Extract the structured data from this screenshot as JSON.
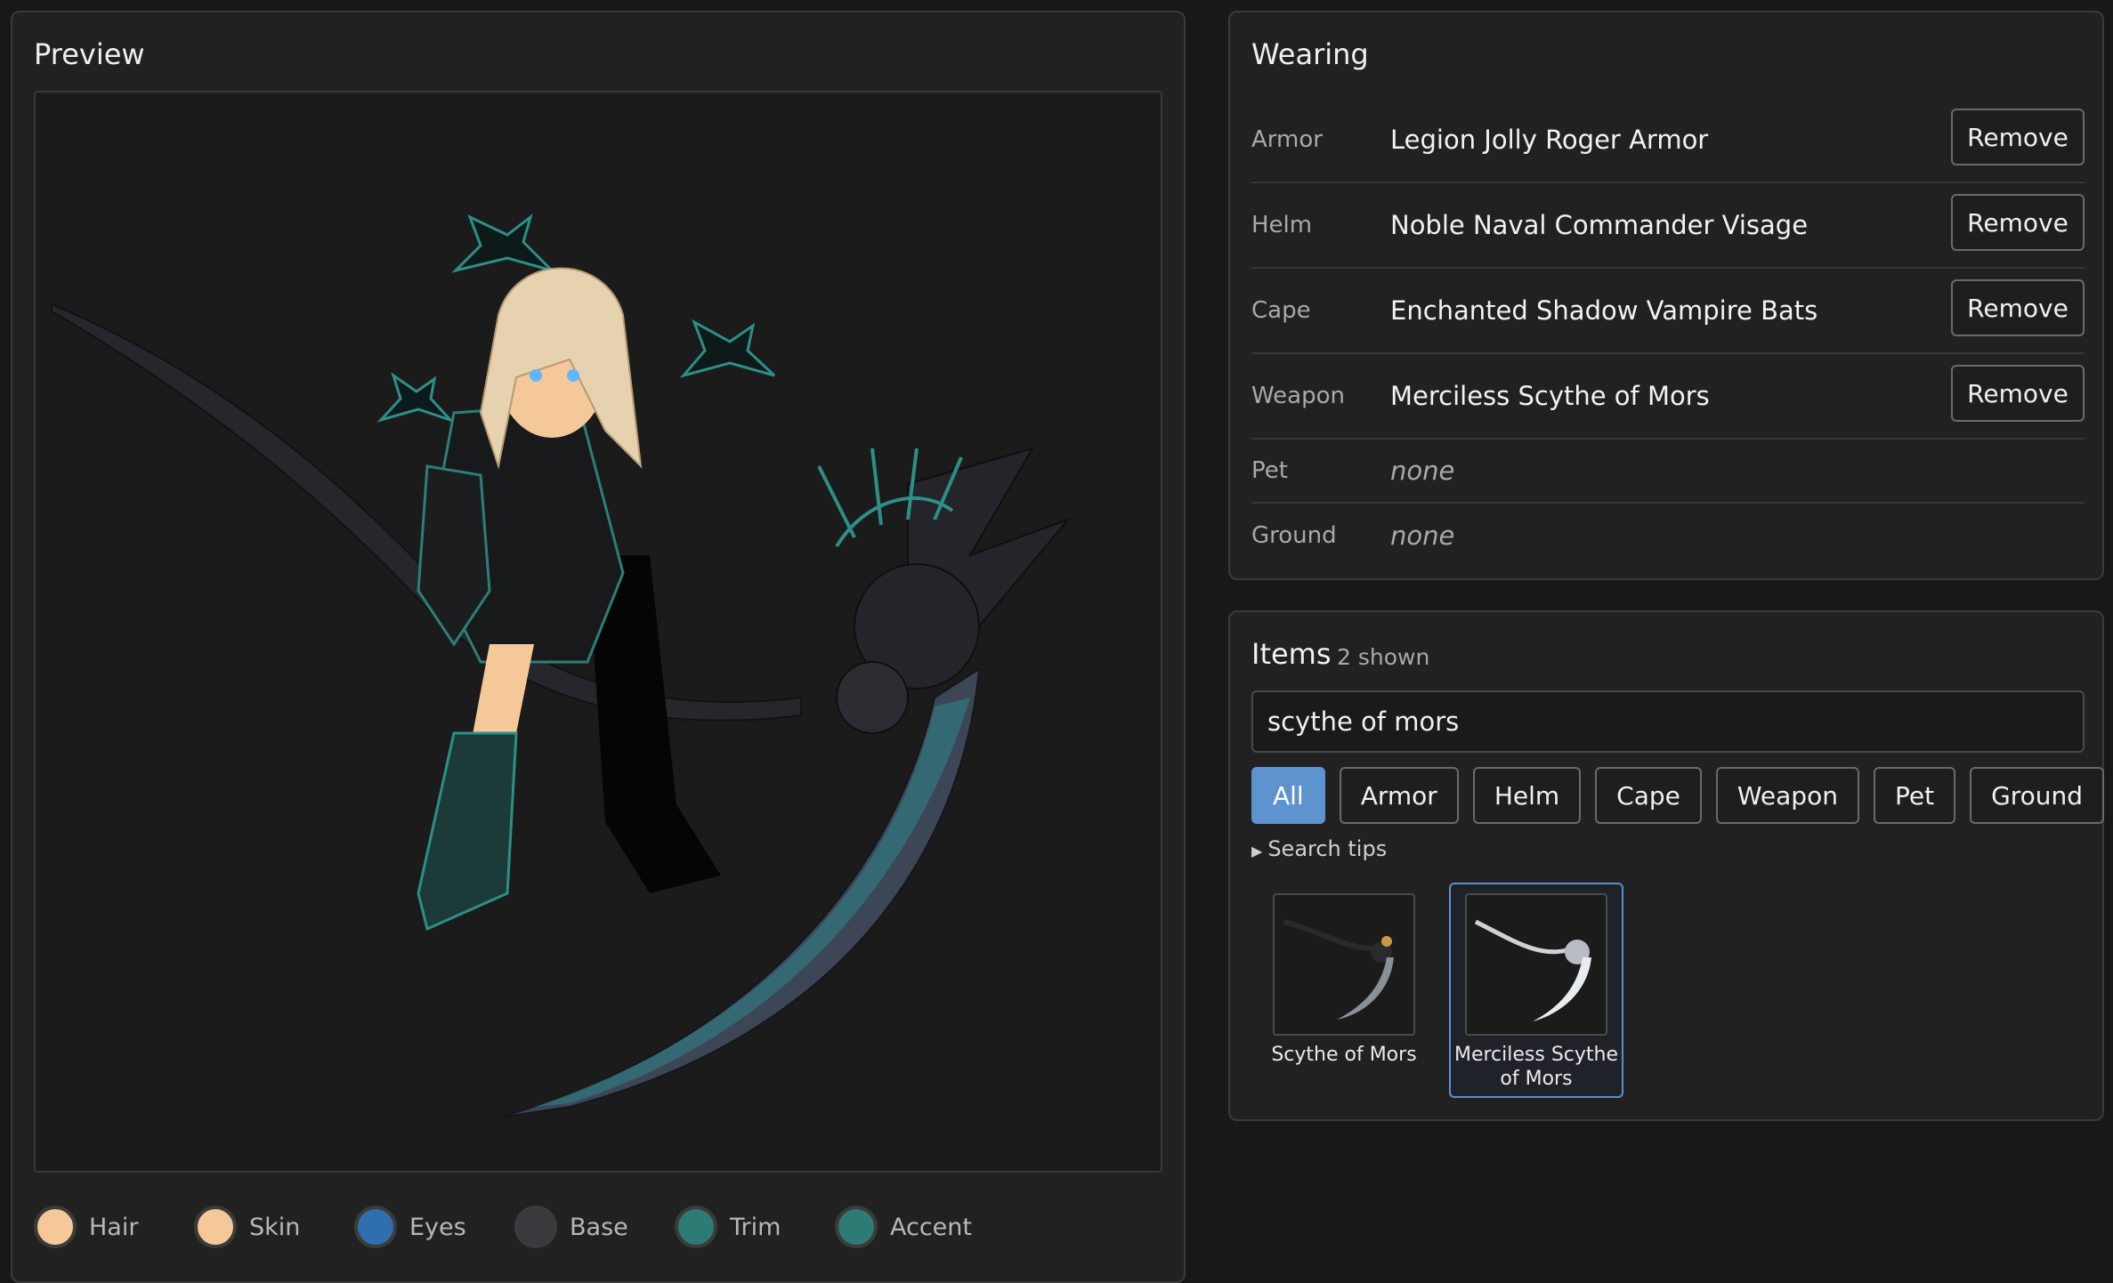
{
  "preview": {
    "title": "Preview",
    "swatches": [
      {
        "label": "Hair",
        "color": "#f5c89a"
      },
      {
        "label": "Skin",
        "color": "#f5c89a"
      },
      {
        "label": "Eyes",
        "color": "#2f6fae"
      },
      {
        "label": "Base",
        "color": "#3a3a3e"
      },
      {
        "label": "Trim",
        "color": "#2e7a74"
      },
      {
        "label": "Accent",
        "color": "#2e7a74"
      }
    ]
  },
  "wearing": {
    "title": "Wearing",
    "remove_label": "Remove",
    "rows": [
      {
        "slot": "Armor",
        "item": "Legion Jolly Roger Armor"
      },
      {
        "slot": "Helm",
        "item": "Noble Naval Commander Visage"
      },
      {
        "slot": "Cape",
        "item": "Enchanted Shadow Vampire Bats"
      },
      {
        "slot": "Weapon",
        "item": "Merciless Scythe of Mors"
      },
      {
        "slot": "Pet",
        "item": "none"
      },
      {
        "slot": "Ground",
        "item": "none"
      }
    ]
  },
  "items": {
    "title": "Items",
    "count": "2 shown",
    "search_value": "scythe of mors",
    "filters": [
      "All",
      "Armor",
      "Helm",
      "Cape",
      "Weapon",
      "Pet",
      "Ground"
    ],
    "active_filter": "All",
    "tips_label": "Search tips",
    "results": [
      {
        "name": "Scythe of Mors",
        "selected": false,
        "icon": "scythe-icon"
      },
      {
        "name": "Merciless Scythe of Mors",
        "selected": true,
        "icon": "scythe-icon"
      }
    ]
  }
}
